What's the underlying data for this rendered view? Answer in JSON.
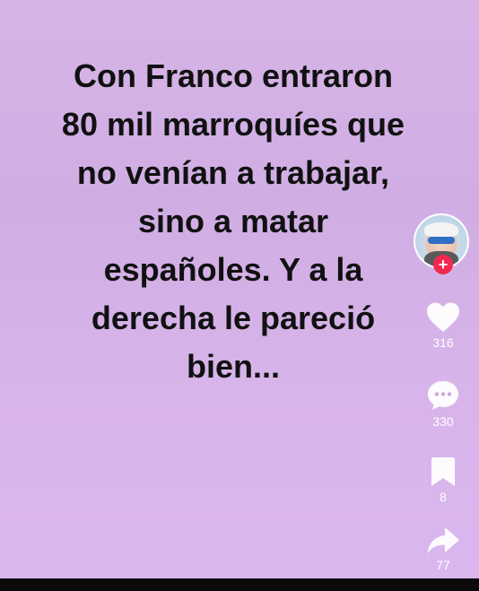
{
  "post": {
    "text": "Con Franco entraron\n80 mil marroquíes que\nno venían a trabajar,\nsino a matar\nespañoles. Y a la\nderecha le pareció\nbien..."
  },
  "actions": {
    "likes": "316",
    "comments": "330",
    "saves": "8",
    "shares": "77"
  },
  "colors": {
    "background": "#d6b4e6",
    "follow_button": "#f4284f",
    "icon": "#ffffff"
  },
  "icons": [
    "heart-icon",
    "comment-icon",
    "bookmark-icon",
    "share-icon",
    "plus-icon"
  ]
}
